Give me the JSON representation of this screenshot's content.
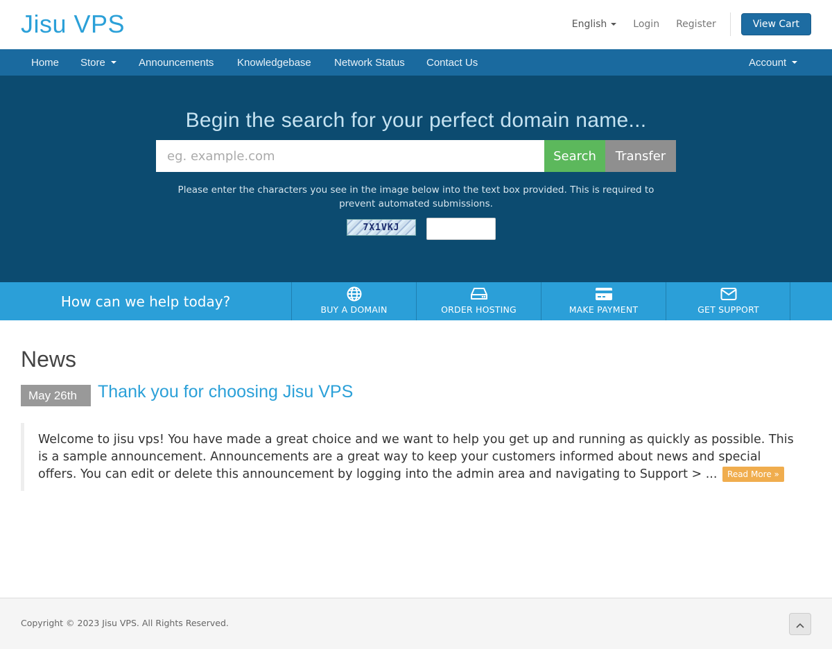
{
  "header": {
    "logo": "Jisu VPS",
    "language": "English",
    "login": "Login",
    "register": "Register",
    "view_cart": "View Cart"
  },
  "nav": {
    "home": "Home",
    "store": "Store",
    "announcements": "Announcements",
    "knowledgebase": "Knowledgebase",
    "network_status": "Network Status",
    "contact_us": "Contact Us",
    "account": "Account"
  },
  "hero": {
    "title": "Begin the search for your perfect domain name...",
    "domain_placeholder": "eg. example.com",
    "search": "Search",
    "transfer": "Transfer",
    "captcha_note": "Please enter the characters you see in the image below into the text box provided. This is required to prevent automated submissions.",
    "captcha_code": "7X1VKJ"
  },
  "help": {
    "title": "How can we help today?",
    "buy_domain": "BUY A DOMAIN",
    "order_hosting": "ORDER HOSTING",
    "make_payment": "MAKE PAYMENT",
    "get_support": "GET SUPPORT"
  },
  "news": {
    "heading": "News",
    "date": "May 26th",
    "title": "Thank you for choosing Jisu VPS",
    "body": "Welcome to jisu vps! You have made a great choice and we want to help you get up and running as quickly as possible. This is a sample announcement. Announcements are a great way to keep your customers informed about news and special offers. You can edit or delete this announcement by logging into the admin area and navigating to Support > ...",
    "read_more": "Read More »"
  },
  "footer": {
    "copyright": "Copyright © 2023 Jisu VPS. All Rights Reserved."
  }
}
